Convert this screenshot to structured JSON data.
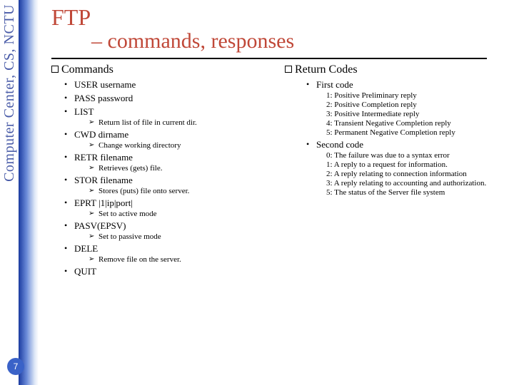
{
  "side_text": "Computer Center, CS, NCTU",
  "page_number": "7",
  "title": "FTP",
  "subtitle": "– commands, responses",
  "left": {
    "heading": "Commands",
    "items": [
      {
        "label": "USER username"
      },
      {
        "label": "PASS password"
      },
      {
        "label": "LIST",
        "sub": [
          "Return list of file in current dir."
        ]
      },
      {
        "label": "CWD dirname",
        "sub": [
          "Change working directory"
        ]
      },
      {
        "label": "RETR filename",
        "sub": [
          "Retrieves (gets) file."
        ]
      },
      {
        "label": "STOR filename",
        "sub": [
          "Stores (puts) file onto server."
        ]
      },
      {
        "label": "EPRT |1|ip|port|",
        "sub": [
          "Set to active mode"
        ]
      },
      {
        "label": "PASV(EPSV)",
        "sub": [
          "Set to passive mode"
        ]
      },
      {
        "label": "DELE",
        "sub": [
          "Remove file on the server."
        ]
      },
      {
        "label": "QUIT"
      }
    ]
  },
  "right": {
    "heading": "Return Codes",
    "items": [
      {
        "label": "First code",
        "codes": [
          "1: Positive Preliminary reply",
          "2: Positive Completion reply",
          "3: Positive Intermediate reply",
          "4: Transient Negative Completion reply",
          "5: Permanent Negative Completion reply"
        ]
      },
      {
        "label": "Second code",
        "codes": [
          "0: The failure was due to a syntax error",
          "1: A reply to a request for information.",
          "2: A reply relating to connection information",
          "3: A reply relating to accounting and authorization.",
          "5: The status of the Server file system"
        ]
      }
    ]
  }
}
